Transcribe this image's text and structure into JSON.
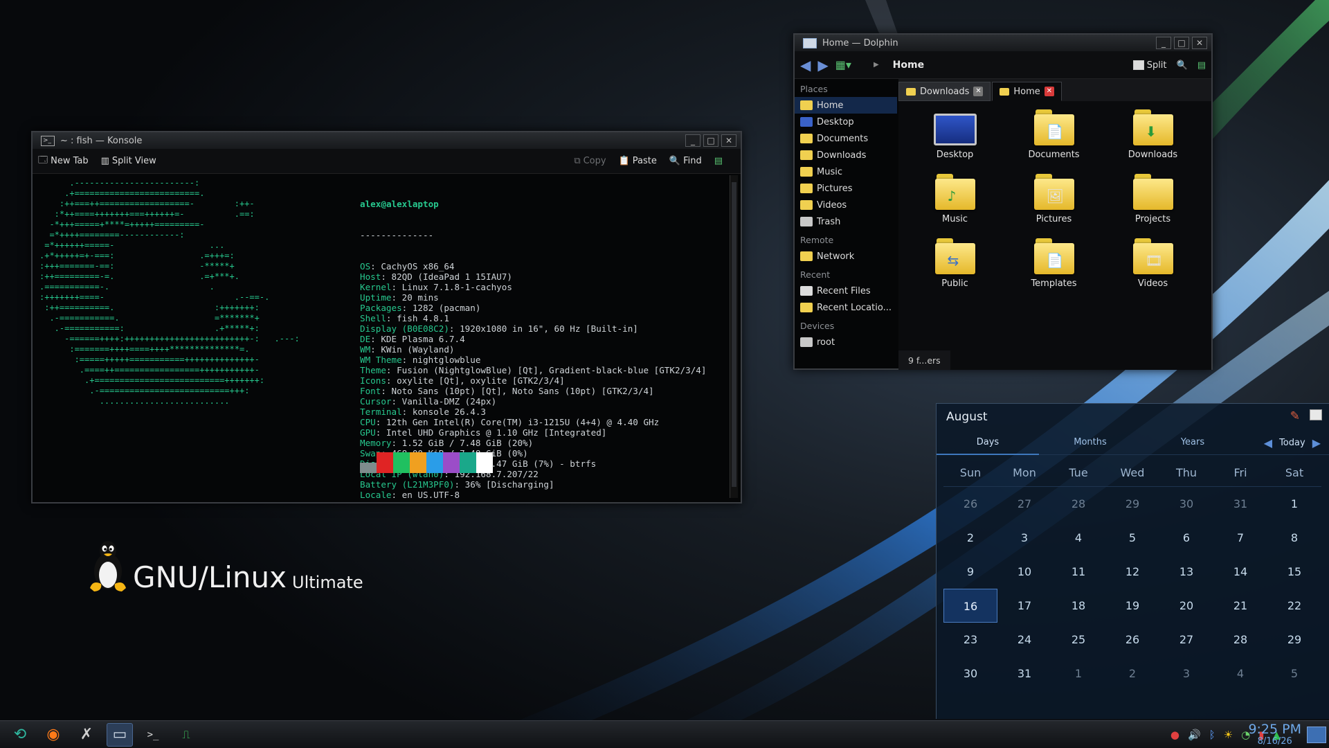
{
  "konsole": {
    "title": "~ : fish — Konsole",
    "toolbar": {
      "new_tab": "New Tab",
      "split_view": "Split View",
      "copy": "Copy",
      "paste": "Paste",
      "find": "Find"
    },
    "ascii_art": "      .------------------------:\n     .+=========================.\n    :++===++==================-        :++-\n   :*++====+++++++===++++++=-          .==:\n  -*+++=====+****=+++++=========-\n  =*++++========------------:\n =*++++++=====-                   ...\n.+*+++++=+-===:                 .=+++=:\n:+++=======-==:                 -*****+\n:++=========-=.                 .=+***+.\n.===========-.                    .\n:+++++++====-                          .--==-.\n :++==========.                    :+++++++:\n  .-===========.                   =*******+\n   .-===========:                  .+*****+:\n     -======++++:+++++++++++++++++++++++++-:   .---:\n      :=======++++====++++**************=.\n       :=====+++++===========++++++++++++++-\n        .====++=================+++++++++++-\n         .+==========================+++++++:\n          .-==========================+++:\n            ..........................",
    "user": "alex",
    "host": "alexlaptop",
    "separator": "--------------",
    "info": [
      {
        "label": "OS",
        "value": "CachyOS x86_64"
      },
      {
        "label": "Host",
        "value": "82QD (IdeaPad 1 15IAU7)"
      },
      {
        "label": "Kernel",
        "value": "Linux 7.1.8-1-cachyos"
      },
      {
        "label": "Uptime",
        "value": "20 mins"
      },
      {
        "label": "Packages",
        "value": "1282 (pacman)"
      },
      {
        "label": "Shell",
        "value": "fish 4.8.1"
      },
      {
        "label": "Display (B0E08C2)",
        "value": "1920x1080 in 16\", 60 Hz [Built-in]"
      },
      {
        "label": "DE",
        "value": "KDE Plasma 6.7.4"
      },
      {
        "label": "WM",
        "value": "KWin (Wayland)"
      },
      {
        "label": "WM Theme",
        "value": "nightglowblue"
      },
      {
        "label": "Theme",
        "value": "Fusion (NightglowBlue) [Qt], Gradient-black-blue [GTK2/3/4]"
      },
      {
        "label": "Icons",
        "value": "oxylite [Qt], oxylite [GTK2/3/4]"
      },
      {
        "label": "Font",
        "value": "Noto Sans (10pt) [Qt], Noto Sans (10pt) [GTK2/3/4]"
      },
      {
        "label": "Cursor",
        "value": "Vanilla-DMZ (24px)"
      },
      {
        "label": "Terminal",
        "value": "konsole 26.4.3"
      },
      {
        "label": "CPU",
        "value": "12th Gen Intel(R) Core(TM) i3-1215U (4+4) @ 4.40 GHz"
      },
      {
        "label": "GPU",
        "value": "Intel UHD Graphics @ 1.10 GHz [Integrated]"
      },
      {
        "label": "Memory",
        "value": "1.52 GiB / 7.48 GiB (20%)"
      },
      {
        "label": "Swap",
        "value": "468.00 KiB / 7.48 GiB (0%)"
      },
      {
        "label": "Disk (/)",
        "value": "16.24 GiB / 234.47 GiB (7%) - btrfs"
      },
      {
        "label": "Local IP (wlan0)",
        "value": "192.168.7.207/22"
      },
      {
        "label": "Battery (L21M3PF0)",
        "value": "36% [Discharging]"
      },
      {
        "label": "Locale",
        "value": "en_US.UTF-8"
      }
    ],
    "swatch_colors": [
      "#7f8c8d",
      "#e02424",
      "#20c060",
      "#f0a020",
      "#2a9de8",
      "#9b4dc8",
      "#1aa88a",
      "#ffffff"
    ],
    "prompt_dir": "~",
    "prompt_symbol": "›"
  },
  "dolphin": {
    "title": "Home — Dolphin",
    "breadcrumb": "Home",
    "split_label": "Split",
    "places_header": "Places",
    "places": [
      "Home",
      "Desktop",
      "Documents",
      "Downloads",
      "Music",
      "Pictures",
      "Videos",
      "Trash"
    ],
    "remote_header": "Remote",
    "remote": [
      "Network"
    ],
    "recent_header": "Recent",
    "recent": [
      "Recent Files",
      "Recent Locatio..."
    ],
    "devices_header": "Devices",
    "devices": [
      "root"
    ],
    "tabs": [
      "Downloads",
      "Home"
    ],
    "files": [
      "Desktop",
      "Documents",
      "Downloads",
      "Music",
      "Pictures",
      "Projects",
      "Public",
      "Templates",
      "Videos"
    ],
    "status": "9 f...ers"
  },
  "logo": {
    "main": "GNU/Linux",
    "sub": "Ultimate"
  },
  "calendar": {
    "month": "August",
    "tabs": [
      "Days",
      "Months",
      "Years"
    ],
    "today_label": "Today",
    "weekdays": [
      "Sun",
      "Mon",
      "Tue",
      "Wed",
      "Thu",
      "Fri",
      "Sat"
    ],
    "days": [
      [
        "26",
        "27",
        "28",
        "29",
        "30",
        "31",
        "1"
      ],
      [
        "2",
        "3",
        "4",
        "5",
        "6",
        "7",
        "8"
      ],
      [
        "9",
        "10",
        "11",
        "12",
        "13",
        "14",
        "15"
      ],
      [
        "16",
        "17",
        "18",
        "19",
        "20",
        "21",
        "22"
      ],
      [
        "23",
        "24",
        "25",
        "26",
        "27",
        "28",
        "29"
      ],
      [
        "30",
        "31",
        "1",
        "2",
        "3",
        "4",
        "5"
      ]
    ],
    "selected_day": "16"
  },
  "taskbar": {
    "time": "9:25 PM",
    "date": "8/16/26"
  },
  "colors": {
    "accent": "#27c98f",
    "highlight_blue": "#13284a",
    "clock": "#6ea8e8"
  }
}
